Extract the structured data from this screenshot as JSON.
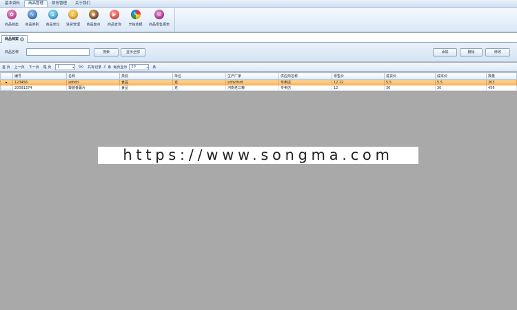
{
  "menubar": {
    "tabs": [
      {
        "label": "基本资料",
        "active": false
      },
      {
        "label": "商品管理",
        "active": true
      },
      {
        "label": "财务管理",
        "active": false
      },
      {
        "label": "关于我们",
        "active": false
      }
    ]
  },
  "toolbar": {
    "buttons": [
      {
        "label": "商品档案",
        "icon": "product-file-icon",
        "color": "#c43b8a"
      },
      {
        "label": "商品类别",
        "icon": "category-icon",
        "color": "#2c6fbf"
      },
      {
        "label": "商品单位",
        "icon": "unit-icon",
        "color": "#2a9ad8"
      },
      {
        "label": "进货管理",
        "icon": "purchase-icon",
        "color": "#f0a020"
      },
      {
        "label": "商品盘点",
        "icon": "inventory-icon",
        "color": "#3a3a4a"
      },
      {
        "label": "商品查询",
        "icon": "query-icon",
        "color": "#e0403a"
      },
      {
        "label": "开始收银",
        "icon": "cashier-icon",
        "color": "#7cb342"
      },
      {
        "label": "商品零售报表",
        "icon": "retail-report-icon",
        "color": "#a02a8a"
      }
    ]
  },
  "doc_tab": {
    "label": "商品档案"
  },
  "search": {
    "label": "商品名称",
    "value": "",
    "placeholder": "",
    "search_button": "搜索",
    "show_all_button": "显示全部",
    "add_button": "添加",
    "delete_button": "删除",
    "edit_button": "修改"
  },
  "pager": {
    "first": "首 页",
    "prev": "上一页",
    "next": "下一页",
    "last": "尾 页",
    "page": "1",
    "go": "Go",
    "total_prefix": "共有记录",
    "total": "2",
    "total_suffix": "条",
    "per_page_label": "每页显示",
    "per_page": "20",
    "per_page_suffix": "条"
  },
  "table": {
    "columns": [
      "编号",
      "名称",
      "类别",
      "单位",
      "生产厂家",
      "供应商名称",
      "零售价",
      "进货价",
      "成本价",
      "数量"
    ],
    "rows": [
      [
        "123456",
        "sdfsfd",
        "食品",
        "克",
        "sdfsdfsdf",
        "专卖店",
        "12.22",
        "5.5",
        "5.5",
        "303"
      ],
      [
        "20091374",
        "袋装番薯片",
        "食品",
        "克",
        "河南老三粮",
        "专卖店",
        "12",
        "30",
        "30",
        "456"
      ]
    ],
    "selected_row": 0
  },
  "watermark": {
    "text": "https://www.songma.com"
  }
}
